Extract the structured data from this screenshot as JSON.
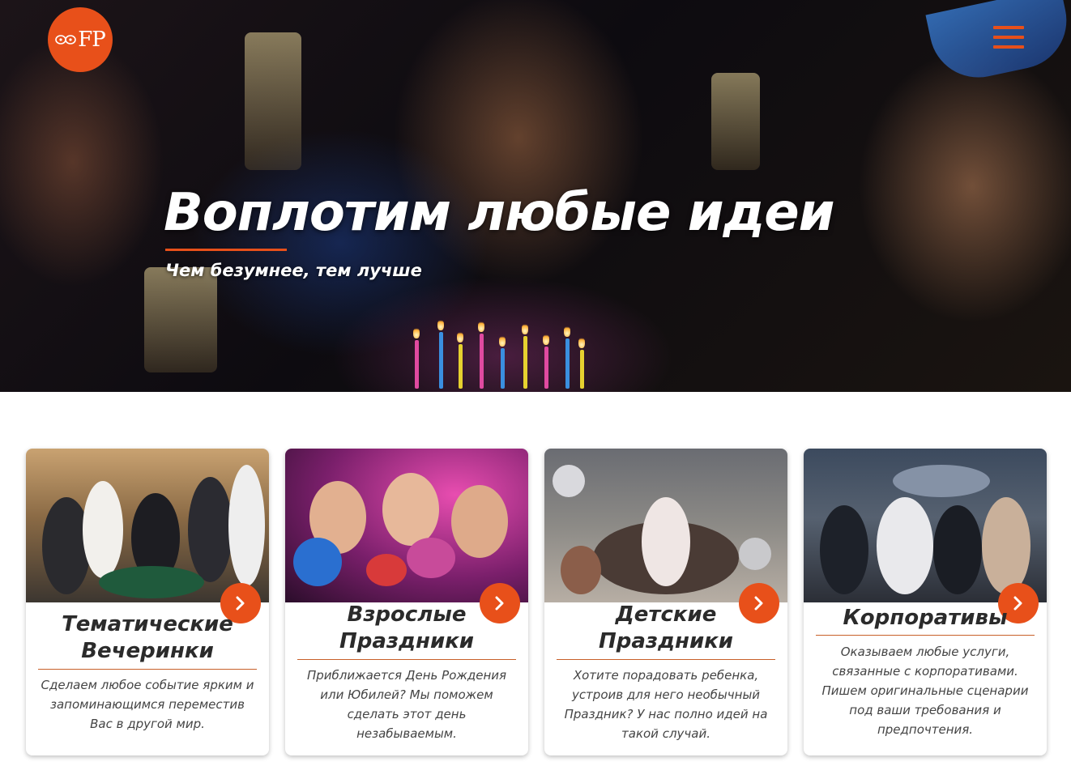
{
  "header": {
    "logo_text": "FP",
    "menu_icon": "hamburger-icon"
  },
  "hero": {
    "title": "Воплотим любые идеи",
    "subtitle": "Чем безумнее, тем лучше"
  },
  "cards": [
    {
      "title": "Тематические Вечеринки",
      "text": "Сделаем любое событие ярким и запоминающимся переместив Вас в другой мир.",
      "arrow_icon": "chevron-right-icon"
    },
    {
      "title": "Взрослые Праздники",
      "text": "Приближается День Рождения или Юбилей? Мы поможем сделать этот день незабываемым.",
      "arrow_icon": "chevron-right-icon"
    },
    {
      "title": "Детские Праздники",
      "text": "Хотите порадовать ребенка, устроив для него необычный Праздник? У нас полно идей на такой случай.",
      "arrow_icon": "chevron-right-icon"
    },
    {
      "title": "Корпоративы",
      "text": "Оказываем любые услуги, связанные с корпоративами. Пишем оригинальные сценарии под ваши требования и предпочтения.",
      "arrow_icon": "chevron-right-icon"
    }
  ],
  "colors": {
    "accent": "#e8501a",
    "text_dark": "#2b2b2b",
    "text_body": "#444444",
    "background": "#ffffff"
  }
}
